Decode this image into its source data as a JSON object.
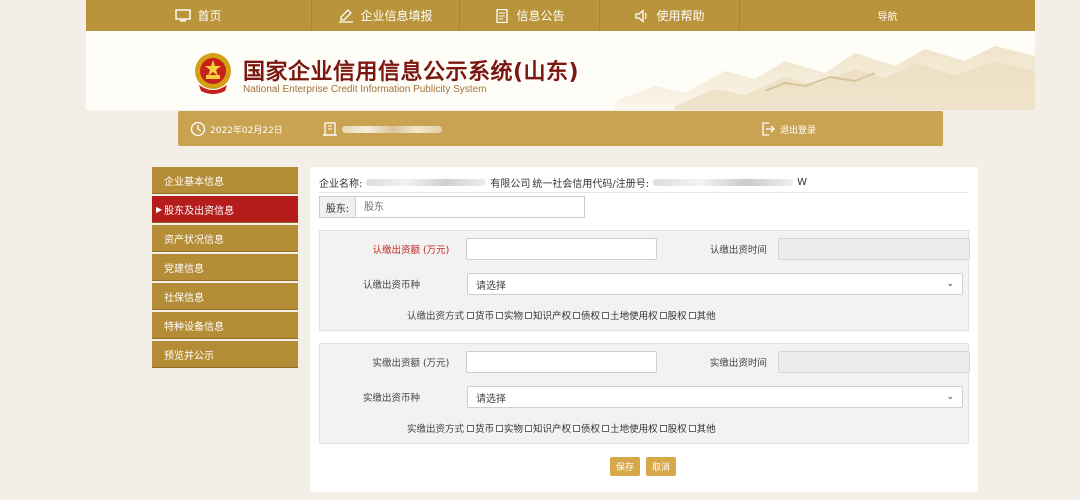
{
  "nav": {
    "items": [
      {
        "label": "首页",
        "icon": "monitor-icon"
      },
      {
        "label": "企业信息填报",
        "icon": "edit-icon"
      },
      {
        "label": "信息公告",
        "icon": "document-icon"
      },
      {
        "label": "使用帮助",
        "icon": "speaker-icon"
      },
      {
        "label": "导航",
        "icon": ""
      }
    ]
  },
  "header": {
    "title": "国家企业信用信息公示系统(山东)",
    "subtitle": "National Enterprise Credit Information Publicity System"
  },
  "infobar": {
    "date": "2022年02月22日",
    "logout": "退出登录"
  },
  "sidebar": {
    "items": [
      {
        "label": "企业基本信息"
      },
      {
        "label": "股东及出资信息",
        "active": true
      },
      {
        "label": "资产状况信息"
      },
      {
        "label": "党建信息"
      },
      {
        "label": "社保信息"
      },
      {
        "label": "特种设备信息"
      },
      {
        "label": "预览并公示"
      }
    ]
  },
  "main": {
    "company_label": "企业名称:",
    "company_suffix": "有限公司",
    "credit_label": "统一社会信用代码/注册号:",
    "credit_suffix": "W",
    "shareholder_label": "股东:",
    "shareholder_placeholder": "股东",
    "subscribed": {
      "amount_label": "认缴出资额 (万元)",
      "time_label": "认缴出资时间",
      "currency_label": "认缴出资币种",
      "currency_value": "请选择",
      "method_label": "认缴出资方式"
    },
    "paid": {
      "amount_label": "实缴出资额 (万元)",
      "time_label": "实缴出资时间",
      "currency_label": "实缴出资币种",
      "currency_value": "请选择",
      "method_label": "实缴出资方式"
    },
    "methods": [
      "货币",
      "实物",
      "知识产权",
      "债权",
      "土地使用权",
      "股权",
      "其他"
    ],
    "save": "保存",
    "cancel": "取消"
  },
  "colors": {
    "nav_bg": "#b9943a",
    "infobar_bg": "#c9a352",
    "sidebar_bg": "#b58d37",
    "sidebar_active": "#b51d1d",
    "title_red": "#7a1710",
    "button": "#d6a84a"
  }
}
